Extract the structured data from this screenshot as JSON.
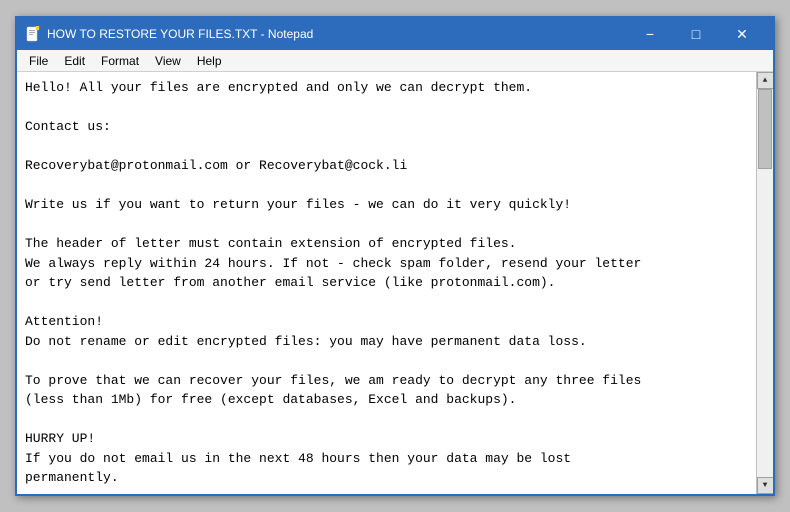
{
  "window": {
    "title": "HOW TO RESTORE YOUR FILES.TXT - Notepad",
    "icon": "notepad"
  },
  "titlebar": {
    "minimize_label": "−",
    "maximize_label": "□",
    "close_label": "✕"
  },
  "menubar": {
    "items": [
      "File",
      "Edit",
      "Format",
      "View",
      "Help"
    ]
  },
  "content": {
    "text": "Hello! All your files are encrypted and only we can decrypt them.\n\nContact us:\n\nRecoverybat@protonmail.com or Recoverybat@cock.li\n\nWrite us if you want to return your files - we can do it very quickly!\n\nThe header of letter must contain extension of encrypted files.\nWe always reply within 24 hours. If not - check spam folder, resend your letter\nor try send letter from another email service (like protonmail.com).\n\nAttention!\nDo not rename or edit encrypted files: you may have permanent data loss.\n\nTo prove that we can recover your files, we am ready to decrypt any three files\n(less than 1Mb) for free (except databases, Excel and backups).\n\nHURRY UP!\nIf you do not email us in the next 48 hours then your data may be lost\npermanently."
  }
}
